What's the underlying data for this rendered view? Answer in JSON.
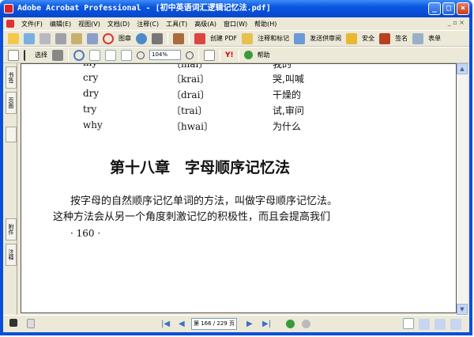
{
  "window": {
    "title": "Adobe Acrobat Professional - [初中英语词汇逻辑记忆法.pdf]",
    "min": "_",
    "max": "□",
    "close": "×"
  },
  "menu": [
    "文件(F)",
    "编辑(E)",
    "视图(V)",
    "文档(D)",
    "注释(C)",
    "工具(T)",
    "高级(A)",
    "窗口(W)",
    "帮助(H)"
  ],
  "toolbar1": {
    "stamp": "图章",
    "create_pdf": "创建 PDF",
    "comment": "注释和标记",
    "send_review": "发送供审阅",
    "security": "安全",
    "sign": "签名",
    "forms": "表单"
  },
  "toolbar2": {
    "select": "选择",
    "zoom": "104%",
    "help": "帮助"
  },
  "nav_tabs": [
    "书签",
    "页面",
    "附件",
    "注释"
  ],
  "page": {
    "rows": [
      {
        "word": "my",
        "phon": "〔mai〕",
        "meaning": "我的"
      },
      {
        "word": "cry",
        "phon": "〔krai〕",
        "meaning": "哭,叫喊"
      },
      {
        "word": "dry",
        "phon": "〔drai〕",
        "meaning": "干燥的"
      },
      {
        "word": "try",
        "phon": "〔trai〕",
        "meaning": "试,审问"
      },
      {
        "word": "why",
        "phon": "〔hwai〕",
        "meaning": "为什么"
      }
    ],
    "chapter": "第十八章　字母顺序记忆法",
    "para1": "按字母的自然顺序记忆单词的方法，叫做字母顺序记忆法。",
    "para2": "这种方法会从另一个角度刺激记忆的积极性，而且会提高我们",
    "page_number": "· 160 ·"
  },
  "status": {
    "page_indicator": "第 166 / 229 页",
    "current_page": 166,
    "total_pages": 229
  }
}
